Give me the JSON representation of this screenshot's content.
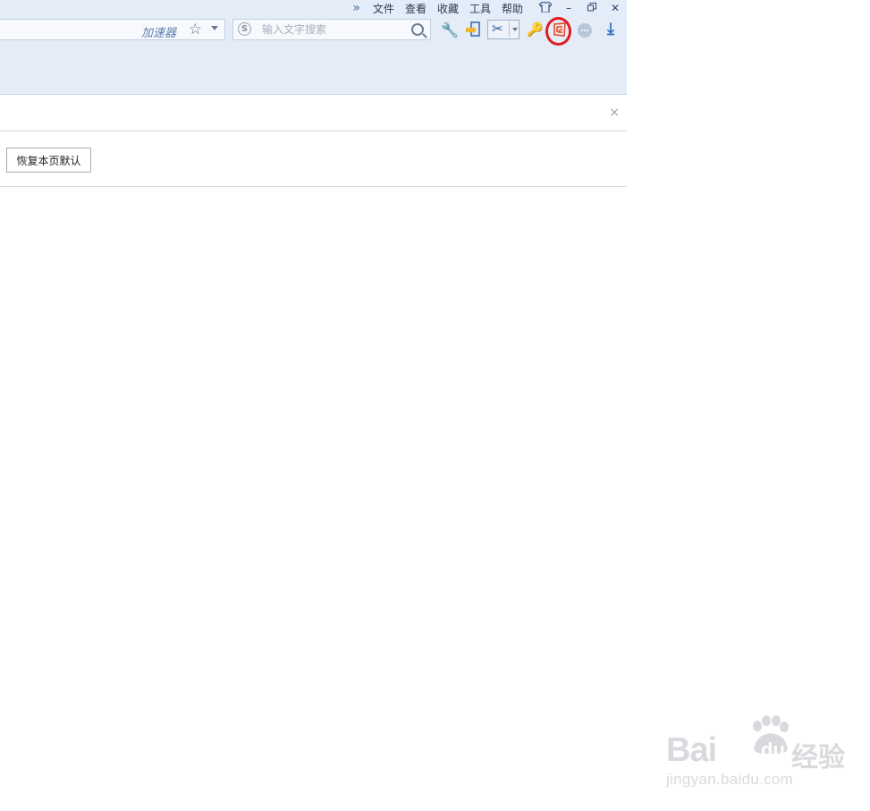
{
  "menubar": {
    "items": [
      "文件",
      "查看",
      "收藏",
      "工具",
      "帮助"
    ],
    "overflow_icon": "double-chevron-right-icon",
    "skin_icon": "tshirt-icon",
    "minimize": "–",
    "restore": "🗗",
    "close": "✕"
  },
  "address_bar": {
    "accelerator_label": "加速器",
    "star_icon": "☆"
  },
  "search": {
    "engine_icon": "S",
    "placeholder": "输入文字搜索"
  },
  "toolbar": {
    "wrench_icon": "🔧",
    "door_icon": "door-exit-icon",
    "scissors_icon": "✂",
    "key_icon": "🔑",
    "download_icon": "⤓"
  },
  "infobar": {
    "close": "×"
  },
  "restore_button": {
    "label": "恢复本页默认"
  },
  "watermark": {
    "brand_latin": "Bai",
    "brand_du": "du",
    "brand_cn": "经验",
    "url": "jingyan.baidu.com"
  },
  "colors": {
    "chrome_bg": "#e3ecf7",
    "highlight_ring": "#e11b22",
    "accent_blue": "#2f6fc2"
  }
}
